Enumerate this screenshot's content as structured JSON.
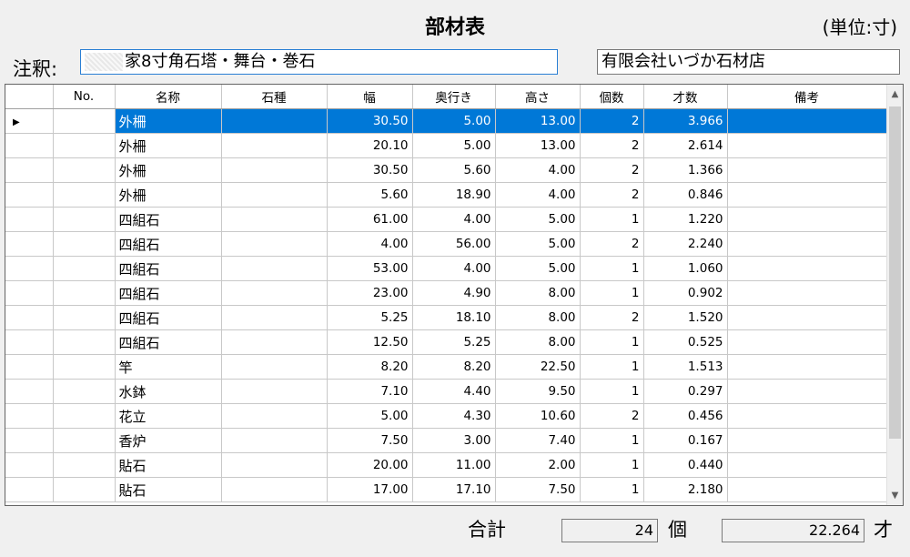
{
  "window": {
    "title": "部材表",
    "unit": "(単位:寸)"
  },
  "note": {
    "label": "注釈:",
    "value": "家8寸角石塔・舞台・巻石"
  },
  "company": {
    "value": "有限会社いづか石材店"
  },
  "table": {
    "columns": [
      "No.",
      "名称",
      "石種",
      "幅",
      "奥行き",
      "高さ",
      "個数",
      "才数",
      "備考"
    ],
    "rows": [
      [
        "",
        "外柵",
        "",
        "30.50",
        "5.00",
        "13.00",
        "2",
        "3.966",
        ""
      ],
      [
        "",
        "外柵",
        "",
        "20.10",
        "5.00",
        "13.00",
        "2",
        "2.614",
        ""
      ],
      [
        "",
        "外柵",
        "",
        "30.50",
        "5.60",
        "4.00",
        "2",
        "1.366",
        ""
      ],
      [
        "",
        "外柵",
        "",
        "5.60",
        "18.90",
        "4.00",
        "2",
        "0.846",
        ""
      ],
      [
        "",
        "四組石",
        "",
        "61.00",
        "4.00",
        "5.00",
        "1",
        "1.220",
        ""
      ],
      [
        "",
        "四組石",
        "",
        "4.00",
        "56.00",
        "5.00",
        "2",
        "2.240",
        ""
      ],
      [
        "",
        "四組石",
        "",
        "53.00",
        "4.00",
        "5.00",
        "1",
        "1.060",
        ""
      ],
      [
        "",
        "四組石",
        "",
        "23.00",
        "4.90",
        "8.00",
        "1",
        "0.902",
        ""
      ],
      [
        "",
        "四組石",
        "",
        "5.25",
        "18.10",
        "8.00",
        "2",
        "1.520",
        ""
      ],
      [
        "",
        "四組石",
        "",
        "12.50",
        "5.25",
        "8.00",
        "1",
        "0.525",
        ""
      ],
      [
        "",
        "竿",
        "",
        "8.20",
        "8.20",
        "22.50",
        "1",
        "1.513",
        ""
      ],
      [
        "",
        "水鉢",
        "",
        "7.10",
        "4.40",
        "9.50",
        "1",
        "0.297",
        ""
      ],
      [
        "",
        "花立",
        "",
        "5.00",
        "4.30",
        "10.60",
        "2",
        "0.456",
        ""
      ],
      [
        "",
        "香炉",
        "",
        "7.50",
        "3.00",
        "7.40",
        "1",
        "0.167",
        ""
      ],
      [
        "",
        "貼石",
        "",
        "20.00",
        "11.00",
        "2.00",
        "1",
        "0.440",
        ""
      ],
      [
        "",
        "貼石",
        "",
        "17.00",
        "17.10",
        "7.50",
        "1",
        "2.180",
        ""
      ]
    ],
    "selected_row": 0
  },
  "totals": {
    "label": "合計",
    "count": "24",
    "count_unit": "個",
    "volume": "22.264",
    "volume_unit": "才"
  },
  "icons": {
    "row_indicator": "triangle-right-icon",
    "scroll_up": "chevron-up-icon",
    "scroll_down": "chevron-down-icon"
  },
  "colors": {
    "selection": "#0078d7",
    "focus_border": "#2a7fd4"
  }
}
